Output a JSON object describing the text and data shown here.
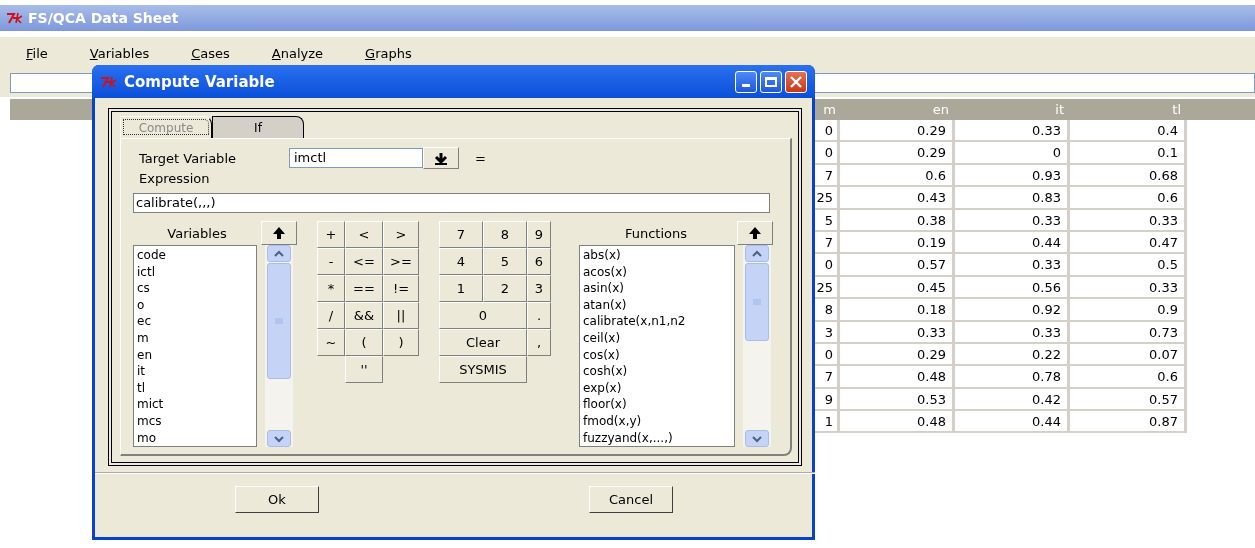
{
  "app": {
    "title": "FS/QCA Data Sheet"
  },
  "menu": [
    {
      "label": "File"
    },
    {
      "label": "Variables"
    },
    {
      "label": "Cases"
    },
    {
      "label": "Analyze"
    },
    {
      "label": "Graphs"
    }
  ],
  "grid": {
    "columns": [
      "m",
      "en",
      "it",
      "tl"
    ],
    "rows": [
      [
        "0",
        "0.29",
        "0.33",
        "0.4"
      ],
      [
        "0",
        "0.29",
        "0",
        "0.1"
      ],
      [
        "7",
        "0.6",
        "0.93",
        "0.68"
      ],
      [
        "25",
        "0.43",
        "0.83",
        "0.6"
      ],
      [
        "5",
        "0.38",
        "0.33",
        "0.33"
      ],
      [
        "7",
        "0.19",
        "0.44",
        "0.47"
      ],
      [
        "0",
        "0.57",
        "0.33",
        "0.5"
      ],
      [
        "25",
        "0.45",
        "0.56",
        "0.33"
      ],
      [
        "8",
        "0.18",
        "0.92",
        "0.9"
      ],
      [
        "3",
        "0.33",
        "0.33",
        "0.73"
      ],
      [
        "0",
        "0.29",
        "0.22",
        "0.07"
      ],
      [
        "7",
        "0.48",
        "0.78",
        "0.6"
      ],
      [
        "9",
        "0.53",
        "0.42",
        "0.57"
      ],
      [
        "1",
        "0.48",
        "0.44",
        "0.87"
      ]
    ]
  },
  "dialog": {
    "title": "Compute Variable",
    "tabs": [
      {
        "label": "Compute",
        "selected": true
      },
      {
        "label": "If",
        "selected": false
      }
    ],
    "target_label": "Target Variable",
    "target_value": "imctl",
    "equals": "=",
    "expression_label": "Expression",
    "expression": "calibrate(,,,)",
    "variables_label": "Variables",
    "variables": [
      "code",
      "ictl",
      "cs",
      "o",
      "ec",
      "m",
      "en",
      "it",
      "tl",
      "mict",
      "mcs",
      "mo"
    ],
    "operators": [
      "+",
      "<",
      ">",
      "-",
      "<=",
      ">=",
      "*",
      "==",
      "!=",
      "/",
      "&&",
      "||",
      "~",
      "(",
      ")",
      "''"
    ],
    "keys": [
      {
        "label": "7",
        "wide": false
      },
      {
        "label": "8",
        "wide": false
      },
      {
        "label": "9",
        "wide": false
      },
      {
        "label": "4",
        "wide": false
      },
      {
        "label": "5",
        "wide": false
      },
      {
        "label": "6",
        "wide": false
      },
      {
        "label": "1",
        "wide": false
      },
      {
        "label": "2",
        "wide": false
      },
      {
        "label": "3",
        "wide": false
      },
      {
        "label": "0",
        "wide": true
      },
      {
        "label": ".",
        "wide": false
      },
      {
        "label": "Clear",
        "wide": true
      },
      {
        "label": ",",
        "wide": false
      },
      {
        "label": "SYSMIS",
        "wide": true
      }
    ],
    "functions_label": "Functions",
    "functions": [
      "abs(x)",
      "acos(x)",
      "asin(x)",
      "atan(x)",
      "calibrate(x,n1,n2",
      "ceil(x)",
      "cos(x)",
      "cosh(x)",
      "exp(x)",
      "floor(x)",
      "fmod(x,y)",
      "fuzzyand(x,...,)"
    ],
    "buttons": [
      "Ok",
      "Cancel"
    ]
  }
}
